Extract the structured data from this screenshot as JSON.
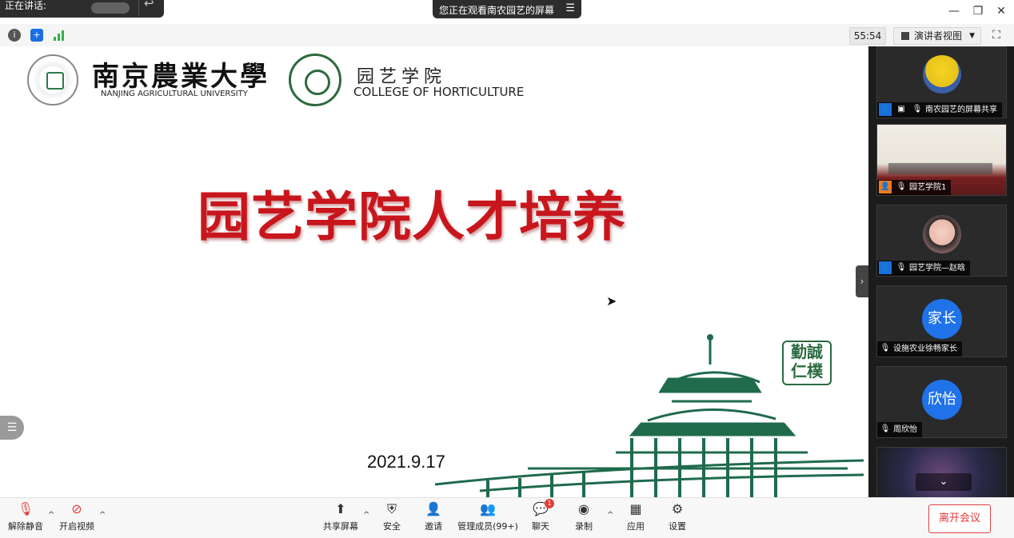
{
  "titlebar": {
    "speaking_label": "正在讲话:",
    "viewing_label": "您正在观看南农园艺的屏幕",
    "viewing_menu_icon": "hamburger-icon",
    "window_controls": {
      "minimize": "—",
      "restore": "❐",
      "close": "✕"
    }
  },
  "infobar": {
    "timer": "55:54",
    "view_mode": "演讲者视图"
  },
  "slide": {
    "njau_name_cn": "南京農業大學",
    "njau_name_en": "NANJING AGRICULTURAL UNIVERSITY",
    "college_name_cn": "园艺学院",
    "college_name_en": "COLLEGE OF HORTICULTURE",
    "title": "园艺学院人才培养",
    "date": "2021.9.17",
    "stamp_text": "勤誠仁樸",
    "building_color": "#1f6b4c",
    "title_color": "#c8161d"
  },
  "gallery": {
    "tiles": [
      {
        "label": "南农园艺的屏幕共享",
        "avatar": "minion",
        "status": "screen-share"
      },
      {
        "label": "园艺学院1",
        "avatar": "video",
        "status": "muted"
      },
      {
        "label": "园艺学院—赵晗",
        "avatar": "photo",
        "status": "muted"
      },
      {
        "label": "设施农业徐畅家长",
        "avatar_text": "家长",
        "status": "muted"
      },
      {
        "label": "周欣怡",
        "avatar_text": "欣怡",
        "status": "muted"
      }
    ]
  },
  "toolbar": {
    "unmute": "解除静音",
    "start_video": "开启视频",
    "share_screen": "共享屏幕",
    "security": "安全",
    "invite": "邀请",
    "participants": "管理成员(99+)",
    "chat": "聊天",
    "chat_badge": "1",
    "record": "录制",
    "apps": "应用",
    "settings": "设置",
    "leave": "离开会议",
    "leave_color": "#e03a3a"
  }
}
